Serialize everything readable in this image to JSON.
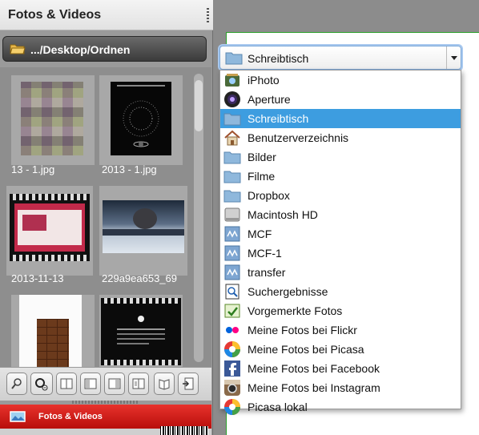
{
  "panel": {
    "title": "Fotos & Videos",
    "path": ".../Desktop/Ordnen",
    "thumbnails": [
      {
        "label": "13 - 1.jpg"
      },
      {
        "label": "2013 - 1.jpg"
      },
      {
        "label": "2013-11-13"
      },
      {
        "label": "229a9ea653_69"
      },
      {
        "label": ""
      },
      {
        "label": ""
      }
    ],
    "footer_tab": "Fotos & Videos"
  },
  "selector": {
    "current": "Schreibtisch",
    "options": [
      {
        "label": "iPhoto",
        "icon": "iphoto-icon"
      },
      {
        "label": "Aperture",
        "icon": "aperture-icon"
      },
      {
        "label": "Schreibtisch",
        "icon": "folder-icon",
        "selected": true
      },
      {
        "label": "Benutzerverzeichnis",
        "icon": "home-icon"
      },
      {
        "label": "Bilder",
        "icon": "folder-icon"
      },
      {
        "label": "Filme",
        "icon": "folder-icon"
      },
      {
        "label": "Dropbox",
        "icon": "folder-icon"
      },
      {
        "label": "Macintosh HD",
        "icon": "hard-drive-icon"
      },
      {
        "label": "MCF",
        "icon": "network-drive-icon"
      },
      {
        "label": "MCF-1",
        "icon": "network-drive-icon"
      },
      {
        "label": "transfer",
        "icon": "network-drive-icon"
      },
      {
        "label": "Suchergebnisse",
        "icon": "search-results-icon"
      },
      {
        "label": "Vorgemerkte Fotos",
        "icon": "bookmark-photos-icon"
      },
      {
        "label": "Meine Fotos bei Flickr",
        "icon": "flickr-icon"
      },
      {
        "label": "Meine Fotos bei Picasa",
        "icon": "picasa-icon"
      },
      {
        "label": "Meine Fotos bei Facebook",
        "icon": "facebook-icon"
      },
      {
        "label": "Meine Fotos bei Instagram",
        "icon": "instagram-icon"
      },
      {
        "label": "Picasa lokal",
        "icon": "picasa-icon"
      }
    ]
  },
  "colors": {
    "accent_red": "#d3201b",
    "selection_blue": "#3d9de0",
    "folder_blue": "#8fb8dc"
  }
}
